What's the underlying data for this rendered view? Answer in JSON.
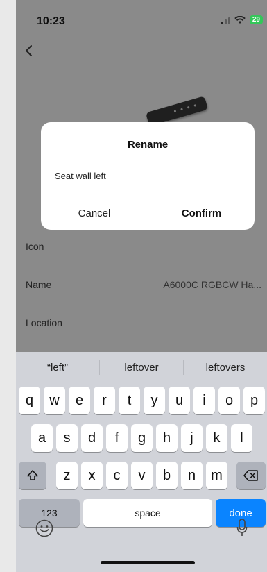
{
  "status_bar": {
    "time": "10:23",
    "battery": "29"
  },
  "settings": {
    "rows": [
      {
        "label": "Icon",
        "value": ""
      },
      {
        "label": "Name",
        "value": "A6000C RGBCW Ha..."
      },
      {
        "label": "Location",
        "value": ""
      }
    ]
  },
  "dialog": {
    "title": "Rename",
    "input_value": "Seat wall left",
    "cancel_label": "Cancel",
    "confirm_label": "Confirm"
  },
  "keyboard": {
    "suggestions": [
      "“left”",
      "leftover",
      "leftovers"
    ],
    "row1": [
      "q",
      "w",
      "e",
      "r",
      "t",
      "y",
      "u",
      "i",
      "o",
      "p"
    ],
    "row2": [
      "a",
      "s",
      "d",
      "f",
      "g",
      "h",
      "j",
      "k",
      "l"
    ],
    "row3": [
      "z",
      "x",
      "c",
      "v",
      "b",
      "n",
      "m"
    ],
    "numbers_label": "123",
    "space_label": "space",
    "done_label": "done",
    "accent_color": "#0a84ff"
  },
  "icons": [
    "back-icon",
    "wifi-icon",
    "shift-icon",
    "delete-icon",
    "emoji-icon",
    "microphone-icon"
  ]
}
